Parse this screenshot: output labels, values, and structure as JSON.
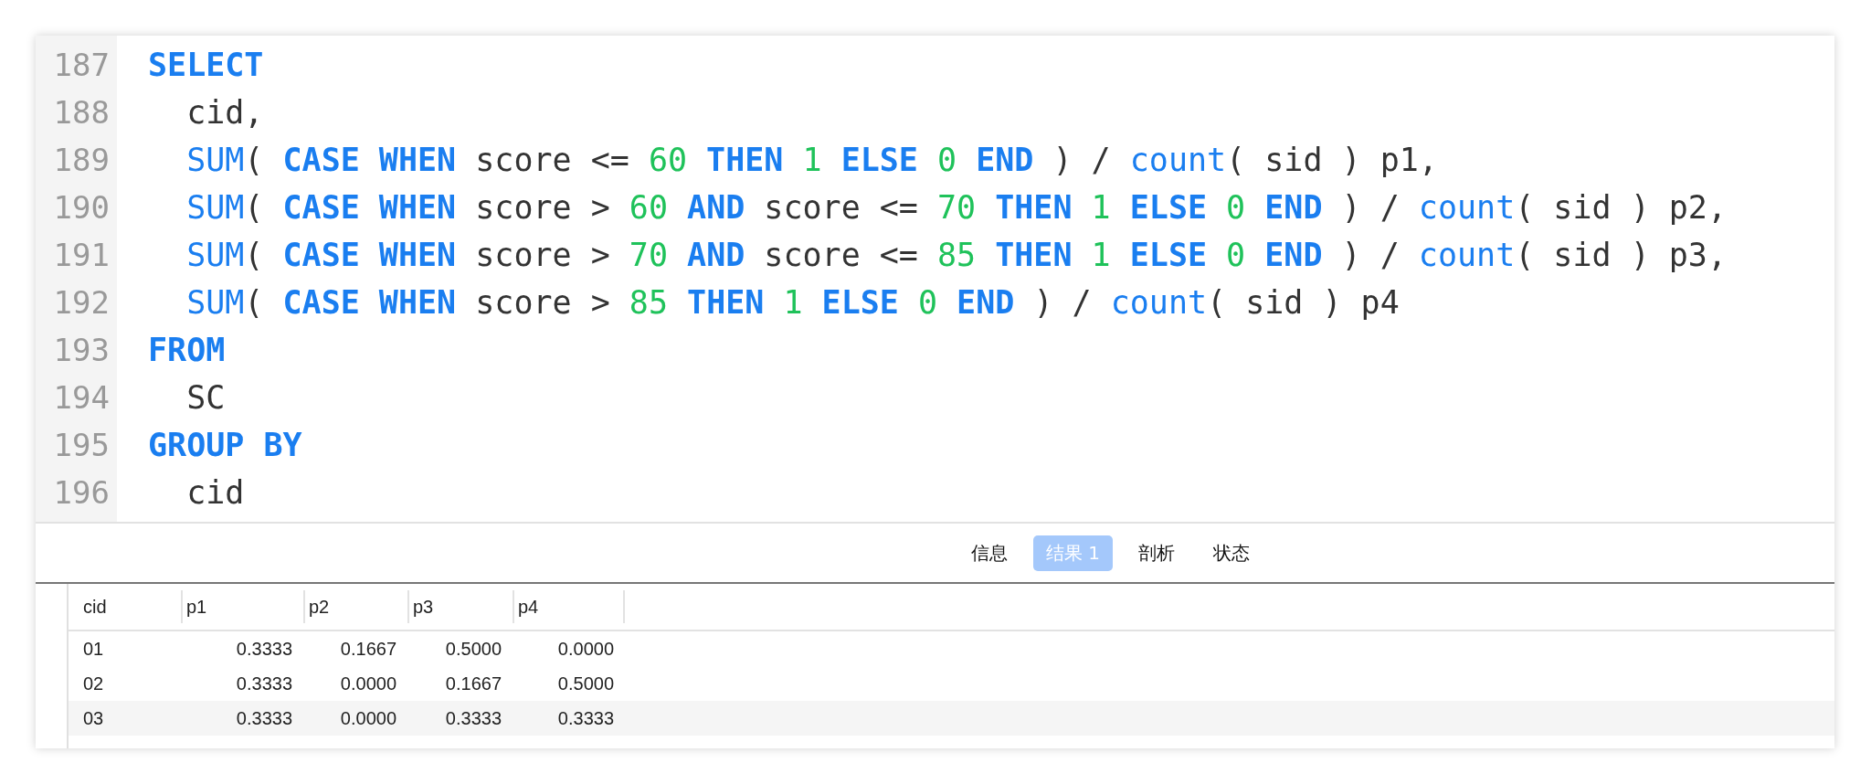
{
  "editor": {
    "lines": [
      {
        "number": "187",
        "tokens": [
          {
            "kind": "keyword",
            "text": "SELECT"
          }
        ]
      },
      {
        "number": "188",
        "tokens": [
          {
            "kind": "plain",
            "text": "  cid,"
          }
        ]
      },
      {
        "number": "189",
        "tokens": [
          {
            "kind": "function",
            "text": "  SUM"
          },
          {
            "kind": "plain",
            "text": "( "
          },
          {
            "kind": "keyword",
            "text": "CASE WHEN"
          },
          {
            "kind": "plain",
            "text": " score <= "
          },
          {
            "kind": "number",
            "text": "60"
          },
          {
            "kind": "keyword",
            "text": " THEN "
          },
          {
            "kind": "number",
            "text": "1"
          },
          {
            "kind": "keyword",
            "text": " ELSE "
          },
          {
            "kind": "number",
            "text": "0"
          },
          {
            "kind": "keyword",
            "text": " END"
          },
          {
            "kind": "plain",
            "text": " ) / "
          },
          {
            "kind": "function",
            "text": "count"
          },
          {
            "kind": "plain",
            "text": "( sid ) p1,"
          }
        ]
      },
      {
        "number": "190",
        "tokens": [
          {
            "kind": "function",
            "text": "  SUM"
          },
          {
            "kind": "plain",
            "text": "( "
          },
          {
            "kind": "keyword",
            "text": "CASE WHEN"
          },
          {
            "kind": "plain",
            "text": " score > "
          },
          {
            "kind": "number",
            "text": "60"
          },
          {
            "kind": "keyword",
            "text": " AND"
          },
          {
            "kind": "plain",
            "text": " score <= "
          },
          {
            "kind": "number",
            "text": "70"
          },
          {
            "kind": "keyword",
            "text": " THEN "
          },
          {
            "kind": "number",
            "text": "1"
          },
          {
            "kind": "keyword",
            "text": " ELSE "
          },
          {
            "kind": "number",
            "text": "0"
          },
          {
            "kind": "keyword",
            "text": " END"
          },
          {
            "kind": "plain",
            "text": " ) / "
          },
          {
            "kind": "function",
            "text": "count"
          },
          {
            "kind": "plain",
            "text": "( sid ) p2,"
          }
        ]
      },
      {
        "number": "191",
        "tokens": [
          {
            "kind": "function",
            "text": "  SUM"
          },
          {
            "kind": "plain",
            "text": "( "
          },
          {
            "kind": "keyword",
            "text": "CASE WHEN"
          },
          {
            "kind": "plain",
            "text": " score > "
          },
          {
            "kind": "number",
            "text": "70"
          },
          {
            "kind": "keyword",
            "text": " AND"
          },
          {
            "kind": "plain",
            "text": " score <= "
          },
          {
            "kind": "number",
            "text": "85"
          },
          {
            "kind": "keyword",
            "text": " THEN "
          },
          {
            "kind": "number",
            "text": "1"
          },
          {
            "kind": "keyword",
            "text": " ELSE "
          },
          {
            "kind": "number",
            "text": "0"
          },
          {
            "kind": "keyword",
            "text": " END"
          },
          {
            "kind": "plain",
            "text": " ) / "
          },
          {
            "kind": "function",
            "text": "count"
          },
          {
            "kind": "plain",
            "text": "( sid ) p3,"
          }
        ]
      },
      {
        "number": "192",
        "tokens": [
          {
            "kind": "function",
            "text": "  SUM"
          },
          {
            "kind": "plain",
            "text": "( "
          },
          {
            "kind": "keyword",
            "text": "CASE WHEN"
          },
          {
            "kind": "plain",
            "text": " score > "
          },
          {
            "kind": "number",
            "text": "85"
          },
          {
            "kind": "keyword",
            "text": " THEN "
          },
          {
            "kind": "number",
            "text": "1"
          },
          {
            "kind": "keyword",
            "text": " ELSE "
          },
          {
            "kind": "number",
            "text": "0"
          },
          {
            "kind": "keyword",
            "text": " END"
          },
          {
            "kind": "plain",
            "text": " ) / "
          },
          {
            "kind": "function",
            "text": "count"
          },
          {
            "kind": "plain",
            "text": "( sid ) p4"
          }
        ]
      },
      {
        "number": "193",
        "tokens": [
          {
            "kind": "keyword",
            "text": "FROM"
          }
        ]
      },
      {
        "number": "194",
        "tokens": [
          {
            "kind": "plain",
            "text": "  SC"
          }
        ]
      },
      {
        "number": "195",
        "tokens": [
          {
            "kind": "keyword",
            "text": "GROUP BY"
          }
        ]
      },
      {
        "number": "196",
        "tokens": [
          {
            "kind": "plain",
            "text": "  cid"
          }
        ]
      }
    ]
  },
  "result_tabs": [
    {
      "label": "信息",
      "selected": false
    },
    {
      "label": "结果 1",
      "selected": true
    },
    {
      "label": "剖析",
      "selected": false
    },
    {
      "label": "状态",
      "selected": false
    }
  ],
  "table": {
    "columns": [
      "cid",
      "p1",
      "p2",
      "p3",
      "p4"
    ],
    "rows": [
      [
        "01",
        "0.3333",
        "0.1667",
        "0.5000",
        "0.0000"
      ],
      [
        "02",
        "0.3333",
        "0.0000",
        "0.1667",
        "0.5000"
      ],
      [
        "03",
        "0.3333",
        "0.0000",
        "0.3333",
        "0.3333"
      ]
    ]
  }
}
